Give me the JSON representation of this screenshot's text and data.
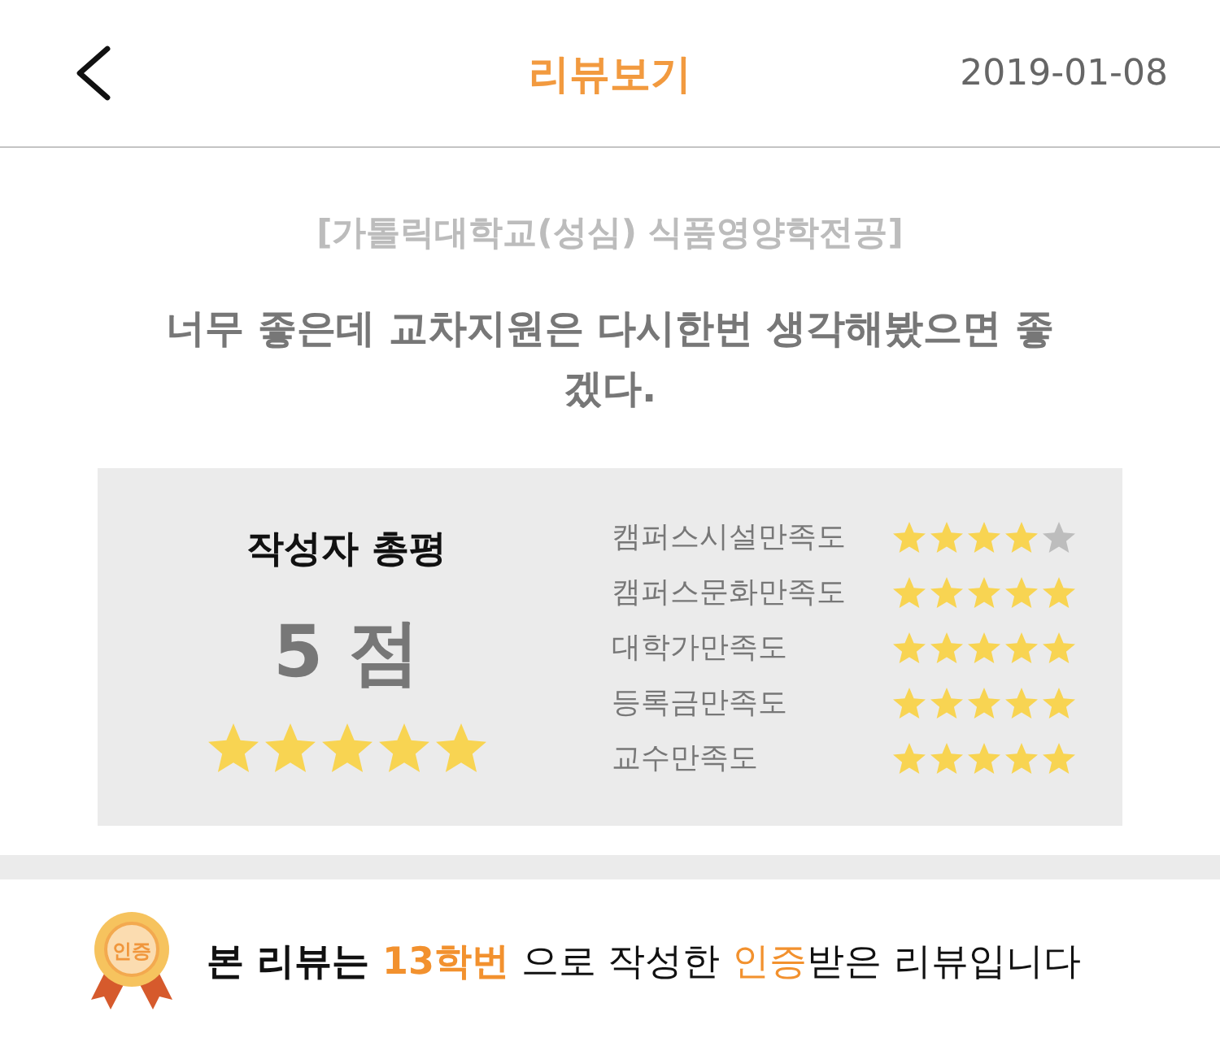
{
  "header": {
    "title": "리뷰보기",
    "date": "2019-01-08"
  },
  "review": {
    "school": "[가톨릭대학교(성심) 식품영양학전공]",
    "headline": "너무 좋은데 교차지원은 다시한번 생각해봤으면 좋겠다."
  },
  "summary": {
    "title": "작성자 총평",
    "score": "5 점",
    "stars": 5
  },
  "ratings": [
    {
      "label": "캠퍼스시설만족도",
      "stars": 4
    },
    {
      "label": "캠퍼스문화만족도",
      "stars": 5
    },
    {
      "label": "대학가만족도",
      "stars": 5
    },
    {
      "label": "등록금만족도",
      "stars": 5
    },
    {
      "label": "교수만족도",
      "stars": 5
    }
  ],
  "certification": {
    "badge_label": "인증",
    "segments": [
      {
        "text": "본 리뷰는 ",
        "bold": true,
        "highlight": false
      },
      {
        "text": "13학번",
        "bold": true,
        "highlight": true
      },
      {
        "text": " 으로 작성한 ",
        "bold": false,
        "highlight": false
      },
      {
        "text": "인증",
        "bold": false,
        "highlight": true
      },
      {
        "text": "받은 리뷰입니다",
        "bold": false,
        "highlight": false
      }
    ]
  }
}
